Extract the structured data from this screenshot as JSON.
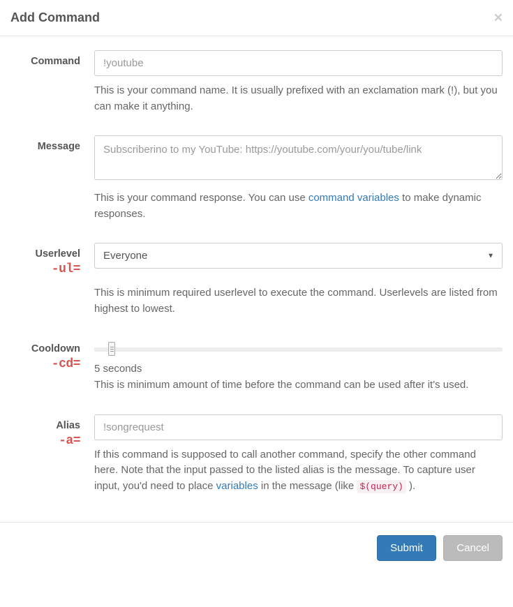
{
  "header": {
    "title": "Add Command",
    "close_label": "×"
  },
  "fields": {
    "command": {
      "label": "Command",
      "placeholder": "!youtube",
      "value": "",
      "help": "This is your command name. It is usually prefixed with an exclamation mark (!), but you can make it anything."
    },
    "message": {
      "label": "Message",
      "placeholder": "Subscriberino to my YouTube: https://youtube.com/your/you/tube/link",
      "value": "",
      "help_before": "This is your command response. You can use ",
      "help_link_text": "command variables",
      "help_after": " to make dynamic responses."
    },
    "userlevel": {
      "label": "Userlevel",
      "annotation": "-ul=",
      "selected": "Everyone",
      "help": "This is minimum required userlevel to execute the command. Userlevels are listed from highest to lowest."
    },
    "cooldown": {
      "label": "Cooldown",
      "annotation": "-cd=",
      "value_display": "5 seconds",
      "help": "This is minimum amount of time before the command can be used after it's used."
    },
    "alias": {
      "label": "Alias",
      "annotation": "-a=",
      "placeholder": "!songrequest",
      "value": "",
      "help_before": "If this command is supposed to call another command, specify the other command here. Note that the input passed to the listed alias is the message. To capture user input, you'd need to place ",
      "help_link_text": "variables",
      "help_after_link": " in the message (like ",
      "help_code": "$(query)",
      "help_after_code": " )."
    }
  },
  "footer": {
    "submit": "Submit",
    "cancel": "Cancel"
  }
}
